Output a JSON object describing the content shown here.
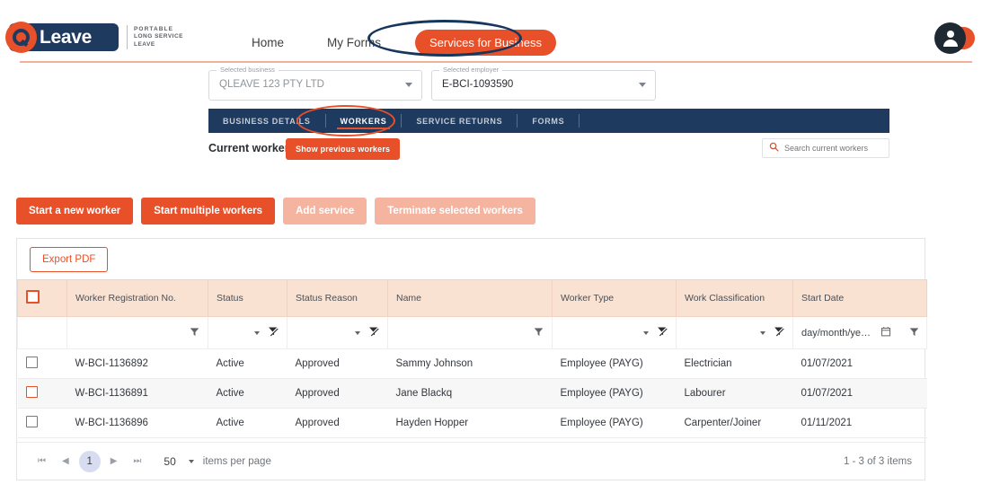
{
  "header": {
    "logo": {
      "word": "Leave",
      "tagline_line1": "PORTABLE",
      "tagline_line2": "LONG SERVICE",
      "tagline_line3": "LEAVE"
    },
    "nav": [
      {
        "label": "Home",
        "name": "nav-home"
      },
      {
        "label": "My Forms",
        "name": "nav-my-forms"
      }
    ],
    "cta_label": "Services for Business",
    "accent_color": "#e8502a",
    "navy_color": "#1e3a5f"
  },
  "selectors": {
    "business": {
      "legend": "Selected business",
      "value": "QLEAVE 123 PTY LTD"
    },
    "employer": {
      "legend": "Selected employer",
      "value": "E-BCI-1093590"
    }
  },
  "tabs": [
    {
      "label": "BUSINESS DETAILS",
      "active": false
    },
    {
      "label": "WORKERS",
      "active": true
    },
    {
      "label": "SERVICE RETURNS",
      "active": false
    },
    {
      "label": "FORMS",
      "active": false
    }
  ],
  "subheader": {
    "title": "Current workers",
    "toggle_label": "Show previous workers",
    "search_placeholder": "Search current workers"
  },
  "actions": [
    {
      "label": "Start a new worker",
      "enabled": true
    },
    {
      "label": "Start multiple workers",
      "enabled": true
    },
    {
      "label": "Add service",
      "enabled": false
    },
    {
      "label": "Terminate selected workers",
      "enabled": false
    }
  ],
  "panel": {
    "export_label": "Export PDF"
  },
  "table": {
    "columns": [
      "Worker Registration No.",
      "Status",
      "Status Reason",
      "Name",
      "Worker Type",
      "Work Classification",
      "Start Date"
    ],
    "date_filter_placeholder": "day/month/ye…",
    "rows": [
      {
        "reg": "W-BCI-1136892",
        "status": "Active",
        "reason": "Approved",
        "name": "Sammy Johnson",
        "type": "Employee (PAYG)",
        "classification": "Electrician",
        "start": "01/07/2021"
      },
      {
        "reg": "W-BCI-1136891",
        "status": "Active",
        "reason": "Approved",
        "name": "Jane Blackq",
        "type": "Employee (PAYG)",
        "classification": "Labourer",
        "start": "01/07/2021"
      },
      {
        "reg": "W-BCI-1136896",
        "status": "Active",
        "reason": "Approved",
        "name": "Hayden Hopper",
        "type": "Employee (PAYG)",
        "classification": "Carpenter/Joiner",
        "start": "01/11/2021"
      }
    ]
  },
  "pager": {
    "page": "1",
    "page_size": "50",
    "items_per_page_label": "items per page",
    "total_label": "1 - 3 of 3 items"
  }
}
